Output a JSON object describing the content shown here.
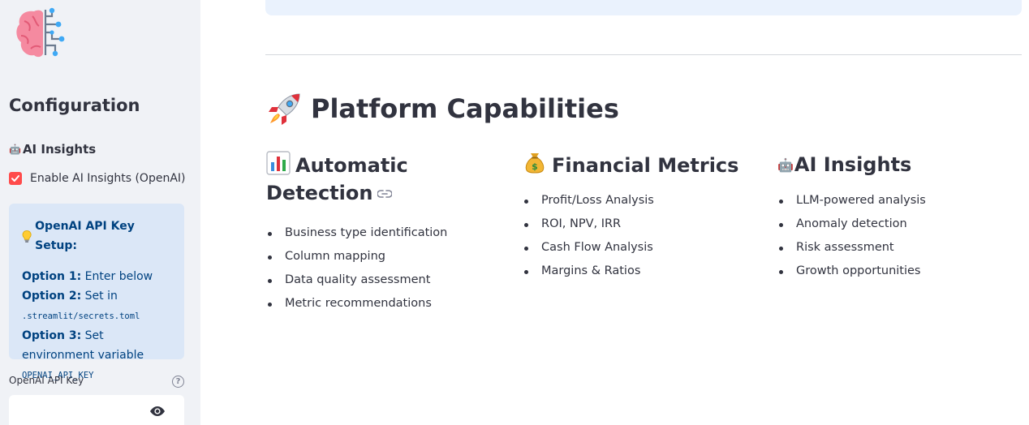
{
  "sidebar": {
    "config_title": "Configuration",
    "ai_section": {
      "icon": "robot-face-icon",
      "title": "AI Insights"
    },
    "enable_checkbox": {
      "label": "Enable AI Insights (OpenAI)",
      "checked": true
    },
    "info_box": {
      "icon": "lightbulb-icon",
      "title": "OpenAI API Key Setup:",
      "option1_label": "Option 1:",
      "option1_text": " Enter below",
      "option2_label": "Option 2:",
      "option2_text": " Set in",
      "option2_code": ".streamlit/secrets.toml",
      "option3_label": "Option 3:",
      "option3_text": " Set environment variable",
      "option3_code": "OPENAI_API_KEY"
    },
    "api_key": {
      "label": "OpenAI API Key",
      "value": "",
      "placeholder": ""
    }
  },
  "main": {
    "heading": {
      "icon": "rocket-icon",
      "title": "Platform Capabilities"
    },
    "columns": [
      {
        "icon": "bar-chart-icon",
        "title": "Automatic Detection",
        "items": [
          "Business type identification",
          "Column mapping",
          "Data quality assessment",
          "Metric recommendations"
        ]
      },
      {
        "icon": "money-bag-icon",
        "title": "Financial Metrics",
        "items": [
          "Profit/Loss Analysis",
          "ROI, NPV, IRR",
          "Cash Flow Analysis",
          "Margins & Ratios"
        ]
      },
      {
        "icon": "robot-face-icon",
        "title": "AI Insights",
        "items": [
          "LLM-powered analysis",
          "Anomaly detection",
          "Risk assessment",
          "Growth opportunities"
        ]
      }
    ]
  },
  "colors": {
    "accent": "#ff4b4b",
    "info_bg": "#dbe7f7",
    "info_text": "#004280",
    "sidebar_bg": "#f0f2f6"
  }
}
